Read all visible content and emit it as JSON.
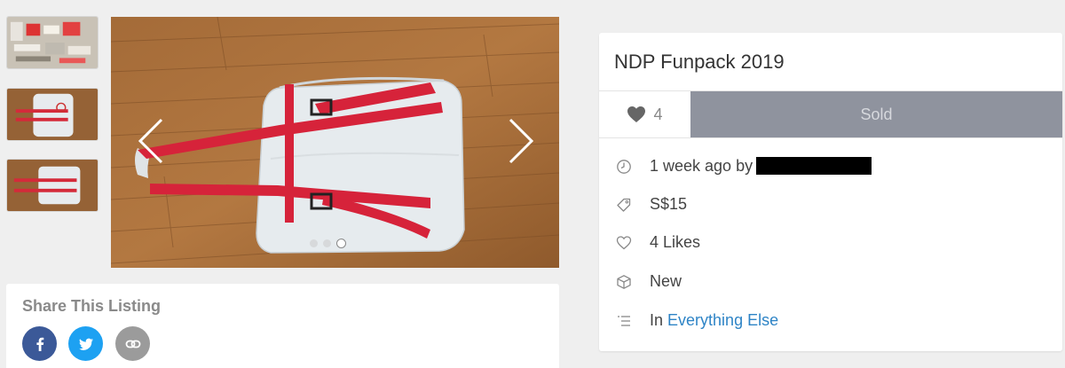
{
  "listing": {
    "title": "NDP Funpack 2019",
    "like_count": "4",
    "status_label": "Sold",
    "details": {
      "posted_prefix": "1 week ago by",
      "price": "S$15",
      "likes": "4 Likes",
      "condition": "New",
      "category_prefix": "In",
      "category": "Everything Else"
    }
  },
  "share": {
    "title": "Share This Listing",
    "buttons": [
      "facebook-icon",
      "twitter-icon",
      "link-icon"
    ]
  },
  "gallery": {
    "thumbnail_count": 3,
    "active_slide": 3,
    "slide_count": 3
  },
  "colors": {
    "facebook": "#3b5998",
    "twitter": "#1da1f2",
    "link": "#9b9b9b",
    "sold_button": "#8f939e",
    "category_link": "#2e84c6"
  }
}
